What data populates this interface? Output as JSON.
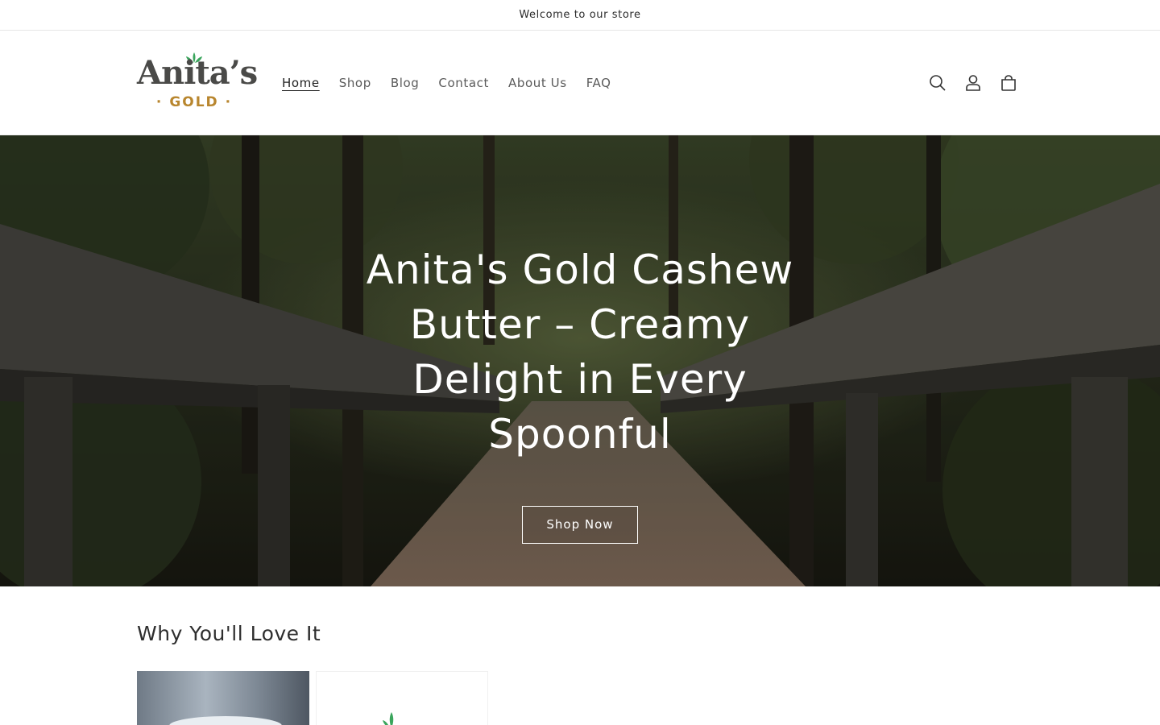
{
  "announcement": {
    "text": "Welcome to our store"
  },
  "logo": {
    "word": "Anita’s",
    "sub": "GOLD"
  },
  "nav": {
    "items": [
      {
        "label": "Home",
        "active": true
      },
      {
        "label": "Shop",
        "active": false
      },
      {
        "label": "Blog",
        "active": false
      },
      {
        "label": "Contact",
        "active": false
      },
      {
        "label": "About Us",
        "active": false
      },
      {
        "label": "FAQ",
        "active": false
      }
    ]
  },
  "header_icons": [
    "search-icon",
    "account-icon",
    "cart-icon"
  ],
  "hero": {
    "title": "Anita's Gold Cashew Butter – Creamy Delight in Every Spoonful",
    "button_label": "Shop Now"
  },
  "features": {
    "title": "Why You'll Love It"
  },
  "colors": {
    "brand_gold": "#b8862e",
    "logo_text": "#4a4a48",
    "leaf_green": "#3aa55c"
  }
}
